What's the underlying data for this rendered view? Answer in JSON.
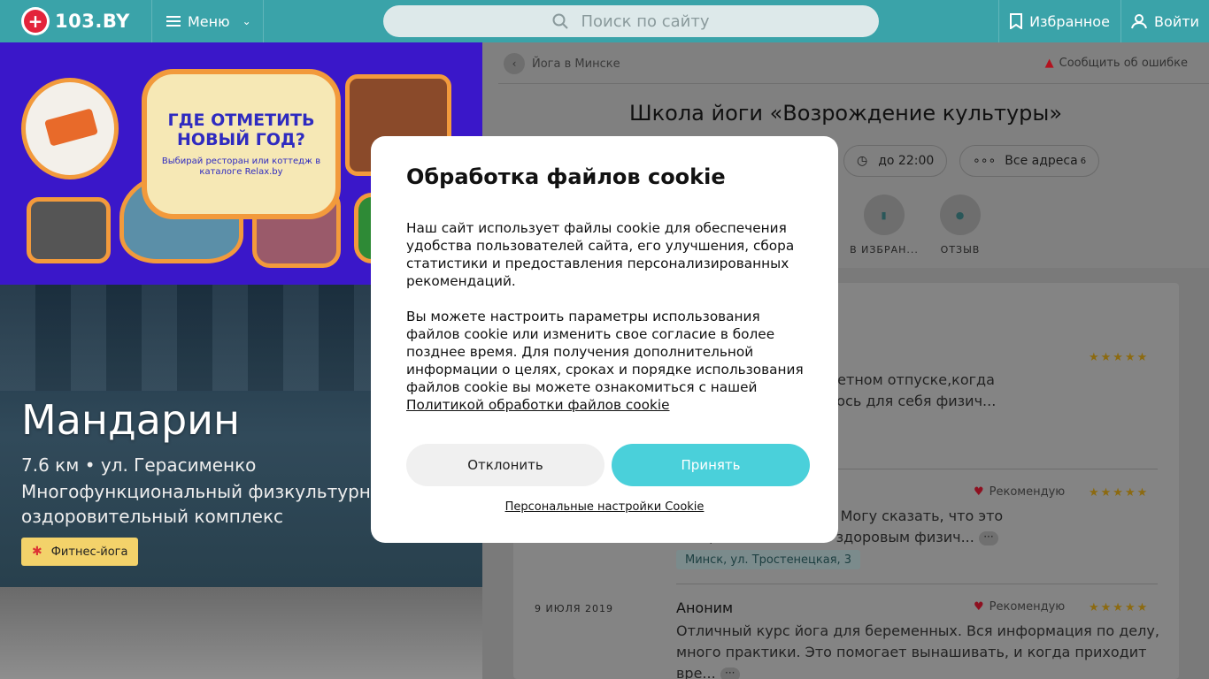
{
  "header": {
    "logo_text": "103.BY",
    "menu_label": "Меню",
    "search_placeholder": "Поиск по сайту",
    "favorites_label": "Избранное",
    "login_label": "Войти"
  },
  "banner": {
    "title": "ГДЕ ОТМЕТИТЬ НОВЫЙ ГОД?",
    "subtitle": "Выбирай ресторан или коттедж в каталоге Relax.by"
  },
  "hero": {
    "name": "Мандарин",
    "address": "7.6 км • ул. Герасименко",
    "description": "Многофункциональный физкультурно-оздоровительный комплекс",
    "tag": "Фитнес-йога"
  },
  "page": {
    "breadcrumb": "Йога в Минске",
    "report_label": "Сообщить об ошибке",
    "title": "Школа йоги «Возрождение культуры»",
    "hours_label": "до 22:00",
    "addresses_label": "Все адреса",
    "addresses_count": "6",
    "action_favorite": "В ИЗБРАН...",
    "action_review": "ОТЗЫВ"
  },
  "reviews": [
    {
      "stars": "★★★★★",
      "text1": "йоги началось в декретном отпуске,когда",
      "text2": "одной стороны хотелось для себя физич...",
      "location": ", 3"
    },
    {
      "recommend": "Рекомендую",
      "stars": "★★★★★",
      "text1": "Развития второй год. Могу сказать, что это",
      "text2": "того, кто хочет быть здоровым физич...",
      "location": "Минск, ул. Тростенецкая, 3"
    },
    {
      "date": "9 ИЮЛЯ 2019",
      "author": "Аноним",
      "recommend": "Рекомендую",
      "stars": "★★★★★",
      "text1": "Отличный курс йога для беременных. Вся информация по делу,",
      "text2": "много практики. Это помогает вынашивать, и когда приходит",
      "text3": "вре..."
    }
  ],
  "cookie_modal": {
    "title": "Обработка файлов cookie",
    "paragraph1": "Наш сайт использует файлы cookie для обеспечения удобства пользователей сайта, его улучшения, сбора статистики и предоставления персонализированных рекомендаций.",
    "paragraph2": "Вы можете настроить параметры использования файлов cookie или изменить свое согласие в более позднее время. Для получения дополнительной информации о целях, сроках и порядке использования файлов cookie вы можете ознакомиться с нашей",
    "policy_link": "Политикой обработки файлов cookie",
    "decline_label": "Отклонить",
    "accept_label": "Принять",
    "personal_settings_label": "Персональные настройки Cookie"
  },
  "colors": {
    "header_bg": "#3aa3a9",
    "accent": "#4ad0da",
    "logo_red": "#e3243b"
  }
}
